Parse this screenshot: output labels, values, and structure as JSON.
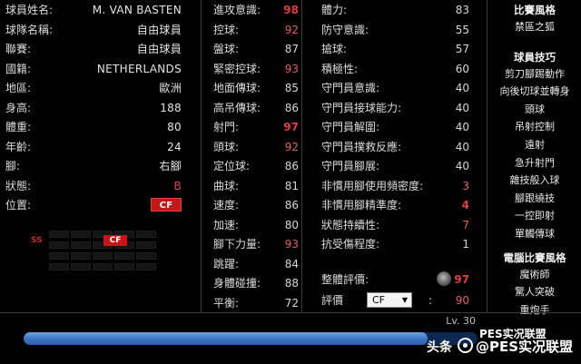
{
  "info": [
    {
      "label": "球員姓名:",
      "value": "M. VAN BASTEN"
    },
    {
      "label": "球隊名稱:",
      "value": "自由球員"
    },
    {
      "label": "聯賽:",
      "value": "自由球員"
    },
    {
      "label": "國籍:",
      "value": "NETHERLANDS"
    },
    {
      "label": "地區:",
      "value": "歐洲"
    },
    {
      "label": "身高:",
      "value": "188"
    },
    {
      "label": "體重:",
      "value": "80"
    },
    {
      "label": "年齡:",
      "value": "24"
    },
    {
      "label": "腳:",
      "value": "右腳"
    },
    {
      "label": "狀態:",
      "value": "B"
    },
    {
      "label": "位置:",
      "value": "CF"
    }
  ],
  "mini_field": {
    "ss": "SS",
    "cf": "CF"
  },
  "attack_stats": [
    {
      "label": "進攻意識:",
      "value": "98",
      "tone": "hi"
    },
    {
      "label": "控球:",
      "value": "92",
      "tone": "mid"
    },
    {
      "label": "盤球:",
      "value": "87",
      "tone": "norm"
    },
    {
      "label": "緊密控球:",
      "value": "93",
      "tone": "mid"
    },
    {
      "label": "地面傳球:",
      "value": "85",
      "tone": "norm"
    },
    {
      "label": "高吊傳球:",
      "value": "86",
      "tone": "norm"
    },
    {
      "label": "射門:",
      "value": "97",
      "tone": "hi"
    },
    {
      "label": "頭球:",
      "value": "92",
      "tone": "mid"
    },
    {
      "label": "定位球:",
      "value": "86",
      "tone": "norm"
    },
    {
      "label": "曲球:",
      "value": "81",
      "tone": "norm"
    },
    {
      "label": "速度:",
      "value": "86",
      "tone": "norm"
    },
    {
      "label": "加速:",
      "value": "80",
      "tone": "norm"
    },
    {
      "label": "腳下力量:",
      "value": "93",
      "tone": "mid"
    },
    {
      "label": "跳躍:",
      "value": "84",
      "tone": "norm"
    },
    {
      "label": "身體碰撞:",
      "value": "88",
      "tone": "norm"
    },
    {
      "label": "平衡:",
      "value": "72",
      "tone": "norm"
    }
  ],
  "defense_stats": [
    {
      "label": "體力:",
      "value": "83",
      "tone": "norm"
    },
    {
      "label": "防守意識:",
      "value": "55",
      "tone": "norm"
    },
    {
      "label": "搶球:",
      "value": "57",
      "tone": "norm"
    },
    {
      "label": "積極性:",
      "value": "60",
      "tone": "norm"
    },
    {
      "label": "守門員意識:",
      "value": "40",
      "tone": "norm"
    },
    {
      "label": "守門員接球能力:",
      "value": "40",
      "tone": "norm"
    },
    {
      "label": "守門員解圍:",
      "value": "40",
      "tone": "norm"
    },
    {
      "label": "守門員撲救反應:",
      "value": "40",
      "tone": "norm"
    },
    {
      "label": "守門員腳展:",
      "value": "40",
      "tone": "norm"
    },
    {
      "label": "非慣用腳使用頻密度:",
      "value": "3",
      "tone": "mid"
    },
    {
      "label": "非慣用腳精準度:",
      "value": "4",
      "tone": "hi"
    },
    {
      "label": "狀態持續性:",
      "value": "7",
      "tone": "mid"
    },
    {
      "label": "抗受傷程度:",
      "value": "1",
      "tone": "norm"
    }
  ],
  "overall": {
    "label": "整體評價:",
    "value": "97"
  },
  "rating": {
    "label": "評價",
    "selected": "CF",
    "value": "90"
  },
  "skills": {
    "style_title": "比賽風格",
    "style_items": [
      "禁區之狐"
    ],
    "skills_title": "球員技巧",
    "skills_items": [
      "剪刀腳踢動作",
      "向後切球並轉身",
      "頭球",
      "吊射控制",
      "遠射",
      "急升射門",
      "雜技般入球",
      "腳跟繞技",
      "一控即射",
      "單觸傳球"
    ],
    "com_title": "電腦比賽風格",
    "com_items": [
      "魔術師",
      "驚人突破",
      "重炮手"
    ]
  },
  "level": {
    "label": "Lv. 30",
    "progress_percent": 89
  },
  "watermark": {
    "prefix": "头条",
    "brand": "@PES实况联盟",
    "overlay": "PES实况联盟"
  }
}
